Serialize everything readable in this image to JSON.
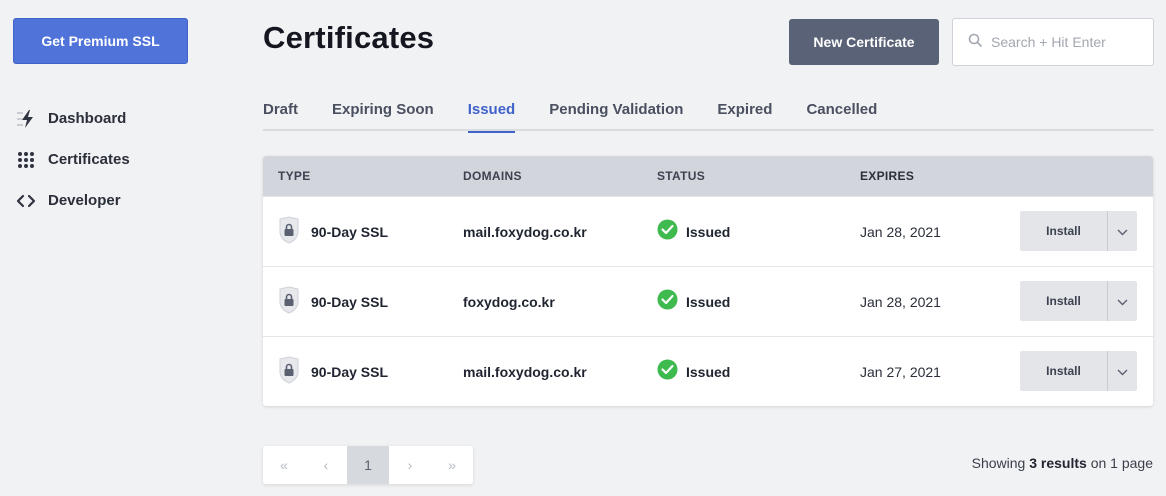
{
  "sidebar": {
    "premium_button": "Get Premium SSL",
    "items": [
      {
        "label": "Dashboard",
        "icon": "lightning-icon"
      },
      {
        "label": "Certificates",
        "icon": "grid-dots-icon"
      },
      {
        "label": "Developer",
        "icon": "code-brackets-icon"
      }
    ]
  },
  "header": {
    "title": "Certificates",
    "new_button": "New Certificate",
    "search_placeholder": "Search + Hit Enter"
  },
  "tabs": [
    {
      "label": "Draft",
      "active": false
    },
    {
      "label": "Expiring Soon",
      "active": false
    },
    {
      "label": "Issued",
      "active": true
    },
    {
      "label": "Pending Validation",
      "active": false
    },
    {
      "label": "Expired",
      "active": false
    },
    {
      "label": "Cancelled",
      "active": false
    }
  ],
  "table": {
    "columns": [
      "TYPE",
      "DOMAINS",
      "STATUS",
      "EXPIRES"
    ],
    "rows": [
      {
        "type": "90-Day SSL",
        "domain": "mail.foxydog.co.kr",
        "status": "Issued",
        "expires": "Jan 28, 2021",
        "action": "Install"
      },
      {
        "type": "90-Day SSL",
        "domain": "foxydog.co.kr",
        "status": "Issued",
        "expires": "Jan 28, 2021",
        "action": "Install"
      },
      {
        "type": "90-Day SSL",
        "domain": "mail.foxydog.co.kr",
        "status": "Issued",
        "expires": "Jan 27, 2021",
        "action": "Install"
      }
    ]
  },
  "pagination": {
    "current_page": "1",
    "first": "«",
    "prev": "‹",
    "next": "›",
    "last": "»"
  },
  "results": {
    "prefix": "Showing",
    "count": "3 results",
    "middle": "on",
    "pages": "1",
    "suffix": "page"
  },
  "colors": {
    "accent": "#4f73d9",
    "active_tab": "#3f63c9",
    "status_ok": "#3fba4f",
    "dark_button": "#5a6278"
  }
}
